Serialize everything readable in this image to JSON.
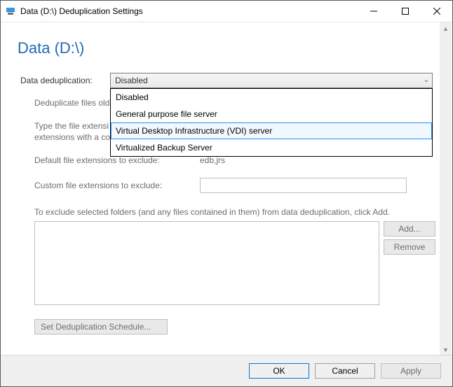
{
  "window": {
    "title": "Data (D:\\) Deduplication Settings"
  },
  "page": {
    "heading": "Data (D:\\)"
  },
  "form": {
    "dedup_label": "Data deduplication:",
    "dedup_selected": "Disabled",
    "dedup_options": {
      "0": "Disabled",
      "1": "General purpose file server",
      "2": "Virtual Desktop Infrastructure (VDI) server",
      "3": "Virtualized Backup Server"
    },
    "dedup_highlight_index": 2,
    "dedup_age_label_partial": "Deduplicate files old",
    "type_ext_label_partial": "Type the file extensi\nextensions with a co",
    "default_ext_label": "Default file extensions to exclude:",
    "default_ext_value": "edb,jrs",
    "custom_ext_label": "Custom file extensions to exclude:",
    "custom_ext_value": "",
    "exclude_folders_text": "To exclude selected folders (and any files contained in them) from data deduplication, click Add.",
    "add_button": "Add...",
    "remove_button": "Remove",
    "schedule_button": "Set Deduplication Schedule..."
  },
  "footer": {
    "ok": "OK",
    "cancel": "Cancel",
    "apply": "Apply"
  }
}
